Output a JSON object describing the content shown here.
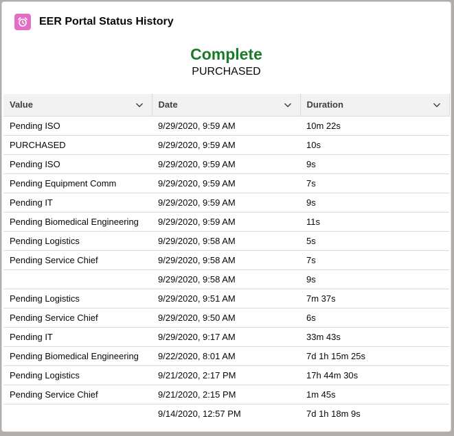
{
  "card": {
    "title": "EER Portal Status History",
    "icon": "alarm-clock-icon",
    "icon_color": "#e36ec8"
  },
  "status": {
    "main": "Complete",
    "sub": "PURCHASED",
    "main_color": "#1b7a2a"
  },
  "table": {
    "columns": [
      "Value",
      "Date",
      "Duration"
    ],
    "rows": [
      {
        "value": "Pending ISO",
        "date": "9/29/2020, 9:59 AM",
        "duration": "10m 22s"
      },
      {
        "value": "PURCHASED",
        "date": "9/29/2020, 9:59 AM",
        "duration": "10s"
      },
      {
        "value": "Pending ISO",
        "date": "9/29/2020, 9:59 AM",
        "duration": "9s"
      },
      {
        "value": "Pending Equipment Comm",
        "date": "9/29/2020, 9:59 AM",
        "duration": "7s"
      },
      {
        "value": "Pending IT",
        "date": "9/29/2020, 9:59 AM",
        "duration": "9s"
      },
      {
        "value": "Pending Biomedical Engineering",
        "date": "9/29/2020, 9:59 AM",
        "duration": "11s"
      },
      {
        "value": "Pending Logistics",
        "date": "9/29/2020, 9:58 AM",
        "duration": "5s"
      },
      {
        "value": "Pending Service Chief",
        "date": "9/29/2020, 9:58 AM",
        "duration": "7s"
      },
      {
        "value": "",
        "date": "9/29/2020, 9:58 AM",
        "duration": "9s"
      },
      {
        "value": "Pending Logistics",
        "date": "9/29/2020, 9:51 AM",
        "duration": "7m 37s"
      },
      {
        "value": "Pending Service Chief",
        "date": "9/29/2020, 9:50 AM",
        "duration": "6s"
      },
      {
        "value": "Pending IT",
        "date": "9/29/2020, 9:17 AM",
        "duration": "33m 43s"
      },
      {
        "value": "Pending Biomedical Engineering",
        "date": "9/22/2020, 8:01 AM",
        "duration": "7d 1h 15m 25s"
      },
      {
        "value": "Pending Logistics",
        "date": "9/21/2020, 2:17 PM",
        "duration": "17h 44m 30s"
      },
      {
        "value": "Pending Service Chief",
        "date": "9/21/2020, 2:15 PM",
        "duration": "1m 45s"
      },
      {
        "value": "",
        "date": "9/14/2020, 12:57 PM",
        "duration": "7d 1h 18m 9s"
      }
    ]
  }
}
